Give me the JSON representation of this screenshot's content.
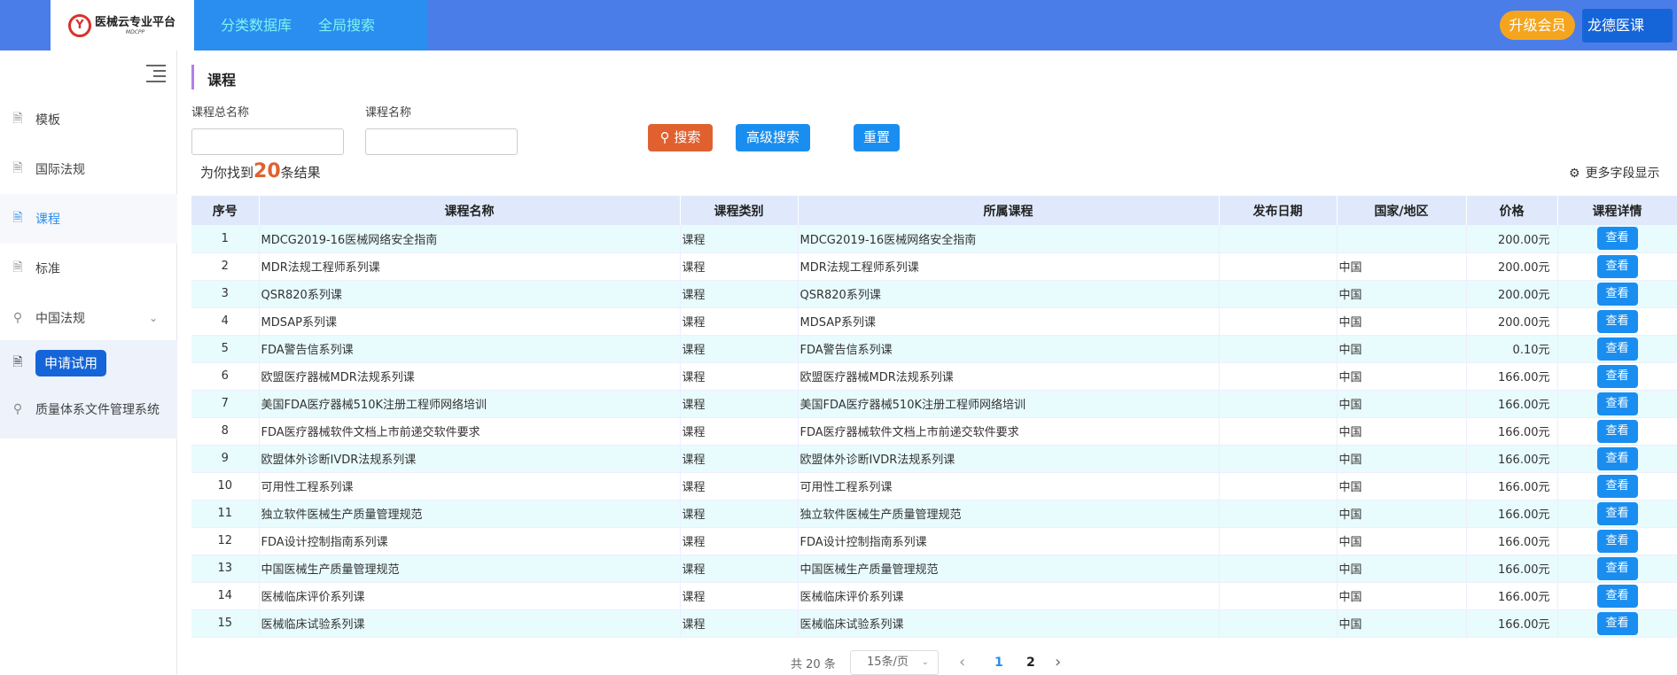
{
  "header": {
    "logo_title": "医械云专业平台",
    "logo_sub": "MDCPP",
    "tabs": [
      "分类数据库",
      "全局搜索"
    ],
    "upgrade_label": "升级会员",
    "user_label": "龙德医课"
  },
  "sidebar": {
    "items": [
      {
        "label": "模板",
        "icon": "document-icon"
      },
      {
        "label": "国际法规",
        "icon": "document-icon"
      },
      {
        "label": "课程",
        "icon": "document-icon"
      },
      {
        "label": "标准",
        "icon": "document-icon"
      },
      {
        "label": "中国法规",
        "icon": "location-icon"
      },
      {
        "label": "申请试用",
        "icon": "document-icon"
      },
      {
        "label": "质量体系文件管理系统",
        "icon": "location-icon"
      }
    ]
  },
  "main": {
    "section_title": "课程",
    "filters": {
      "label1": "课程总名称",
      "value1": "",
      "label2": "课程名称",
      "value2": ""
    },
    "buttons": {
      "search": "搜索",
      "advanced": "高级搜索",
      "reset": "重置"
    },
    "result_prefix": "为你找到",
    "result_count": "20",
    "result_suffix": "条结果",
    "more_fields": "更多字段显示"
  },
  "table": {
    "headers": [
      "序号",
      "课程名称",
      "课程类别",
      "所属课程",
      "发布日期",
      "国家/地区",
      "价格",
      "课程详情"
    ],
    "view_label": "查看",
    "rows": [
      [
        "1",
        "MDCG2019-16医械网络安全指南",
        "课程",
        "MDCG2019-16医械网络安全指南",
        "",
        "",
        "200.00元"
      ],
      [
        "2",
        "MDR法规工程师系列课",
        "课程",
        "MDR法规工程师系列课",
        "",
        "中国",
        "200.00元"
      ],
      [
        "3",
        "QSR820系列课",
        "课程",
        "QSR820系列课",
        "",
        "中国",
        "200.00元"
      ],
      [
        "4",
        "MDSAP系列课",
        "课程",
        "MDSAP系列课",
        "",
        "中国",
        "200.00元"
      ],
      [
        "5",
        "FDA警告信系列课",
        "课程",
        "FDA警告信系列课",
        "",
        "中国",
        "0.10元"
      ],
      [
        "6",
        "欧盟医疗器械MDR法规系列课",
        "课程",
        "欧盟医疗器械MDR法规系列课",
        "",
        "中国",
        "166.00元"
      ],
      [
        "7",
        "美国FDA医疗器械510K注册工程师网络培训",
        "课程",
        "美国FDA医疗器械510K注册工程师网络培训",
        "",
        "中国",
        "166.00元"
      ],
      [
        "8",
        "FDA医疗器械软件文档上市前递交软件要求",
        "课程",
        "FDA医疗器械软件文档上市前递交软件要求",
        "",
        "中国",
        "166.00元"
      ],
      [
        "9",
        "欧盟体外诊断IVDR法规系列课",
        "课程",
        "欧盟体外诊断IVDR法规系列课",
        "",
        "中国",
        "166.00元"
      ],
      [
        "10",
        "可用性工程系列课",
        "课程",
        "可用性工程系列课",
        "",
        "中国",
        "166.00元"
      ],
      [
        "11",
        "独立软件医械生产质量管理规范",
        "课程",
        "独立软件医械生产质量管理规范",
        "",
        "中国",
        "166.00元"
      ],
      [
        "12",
        "FDA设计控制指南系列课",
        "课程",
        "FDA设计控制指南系列课",
        "",
        "中国",
        "166.00元"
      ],
      [
        "13",
        "中国医械生产质量管理规范",
        "课程",
        "中国医械生产质量管理规范",
        "",
        "中国",
        "166.00元"
      ],
      [
        "14",
        "医械临床评价系列课",
        "课程",
        "医械临床评价系列课",
        "",
        "中国",
        "166.00元"
      ],
      [
        "15",
        "医械临床试验系列课",
        "课程",
        "医械临床试验系列课",
        "",
        "中国",
        "166.00元"
      ]
    ]
  },
  "pager": {
    "total": "共 20 条",
    "page_size": "15条/页",
    "prev": "‹",
    "next": "›",
    "pages": [
      "1",
      "2"
    ],
    "current_page": "1"
  },
  "colors": {
    "topbar": "#4a7de8",
    "accent": "#1a8ef0",
    "search_btn": "#e0612f",
    "upgrade": "#f5a51d",
    "row_odd": "#e8fbfd"
  }
}
